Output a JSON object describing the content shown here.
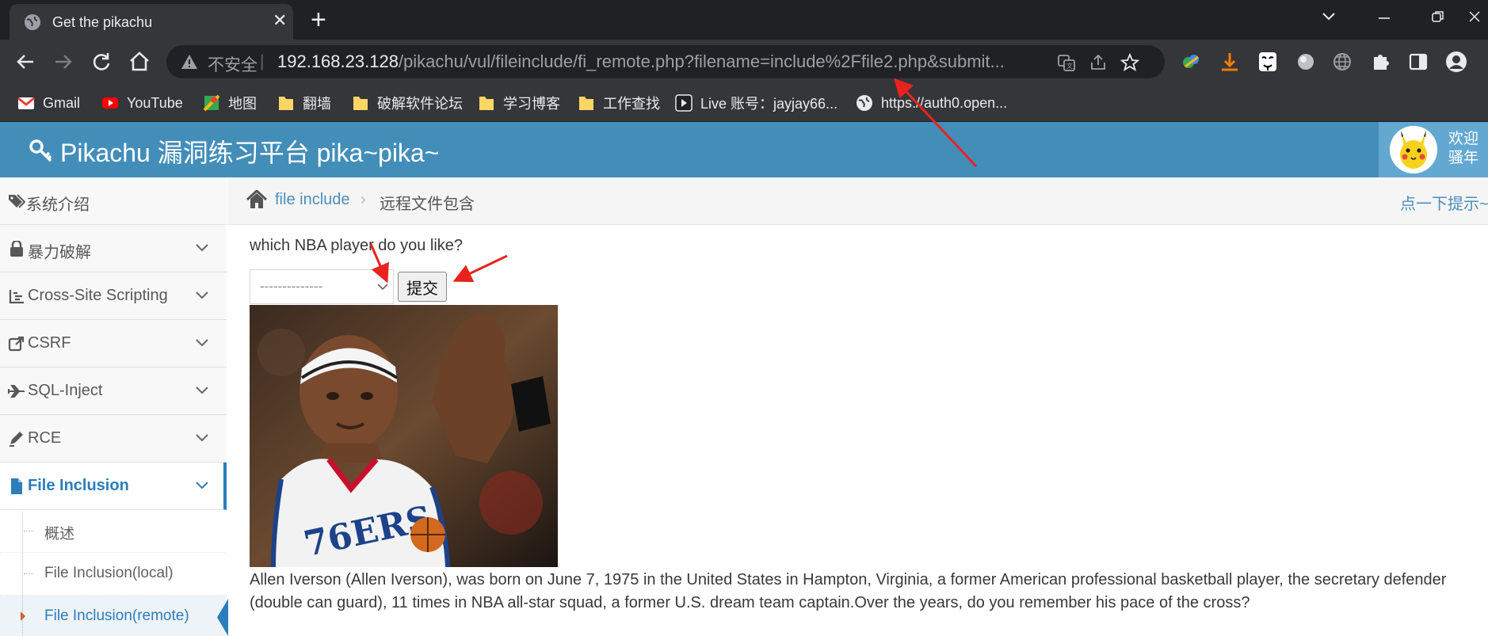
{
  "browser": {
    "tab_title": "Get the pikachu",
    "new_tab_symbol": "+",
    "close_symbol": "✕",
    "omnibox": {
      "insecure_label": "不安全",
      "separator": "|",
      "url_host": "192.168.23.128",
      "url_path": "/pikachu/vul/fileinclude/fi_remote.php?filename=include%2Ffile2.php&submit..."
    },
    "bookmarks": [
      {
        "label": "Gmail",
        "icon": "gmail-icon"
      },
      {
        "label": "YouTube",
        "icon": "youtube-icon"
      },
      {
        "label": "地图",
        "icon": "maps-icon"
      },
      {
        "label": "翻墙",
        "icon": "folder-icon"
      },
      {
        "label": "破解软件论坛",
        "icon": "folder-icon"
      },
      {
        "label": "学习博客",
        "icon": "folder-icon"
      },
      {
        "label": "工作查找",
        "icon": "folder-icon"
      },
      {
        "label": "Live  账号：jayjay66...",
        "icon": "live-icon"
      },
      {
        "label": "https://auth0.open...",
        "icon": "globe-icon"
      }
    ]
  },
  "header": {
    "brand": "Pikachu 漏洞练习平台 pika~pika~",
    "welcome_line1": "欢迎",
    "welcome_line2": "骚年"
  },
  "sidebar": {
    "items": [
      {
        "label": "系统介绍",
        "icon": "tags-icon"
      },
      {
        "label": "暴力破解",
        "icon": "lock-icon"
      },
      {
        "label": "Cross-Site Scripting",
        "icon": "list-icon"
      },
      {
        "label": "CSRF",
        "icon": "share-icon"
      },
      {
        "label": "SQL-Inject",
        "icon": "plane-icon"
      },
      {
        "label": "RCE",
        "icon": "pencil-icon"
      },
      {
        "label": "File Inclusion",
        "icon": "file-icon"
      }
    ],
    "sub_items": [
      {
        "label": "概述"
      },
      {
        "label": "File Inclusion(local)"
      },
      {
        "label": "File Inclusion(remote)"
      }
    ]
  },
  "breadcrumbs": {
    "link": "file include",
    "separator": "›",
    "current": "远程文件包含",
    "hint": "点一下提示~"
  },
  "main": {
    "question": "which NBA player do you like?",
    "select_value": "--------------",
    "submit_label": "提交",
    "description": "Allen Iverson (Allen Iverson), was born on June 7, 1975 in the United States in Hampton, Virginia, a former American professional basketball player, the secretary defender (double can guard), 11 times in NBA all-star squad, a former U.S. dream team captain.Over the years, do you remember his pace of the cross?"
  },
  "colors": {
    "header_blue": "#438eb9",
    "accent_blue": "#2b7dbc",
    "annotation_red": "#e8231f"
  }
}
